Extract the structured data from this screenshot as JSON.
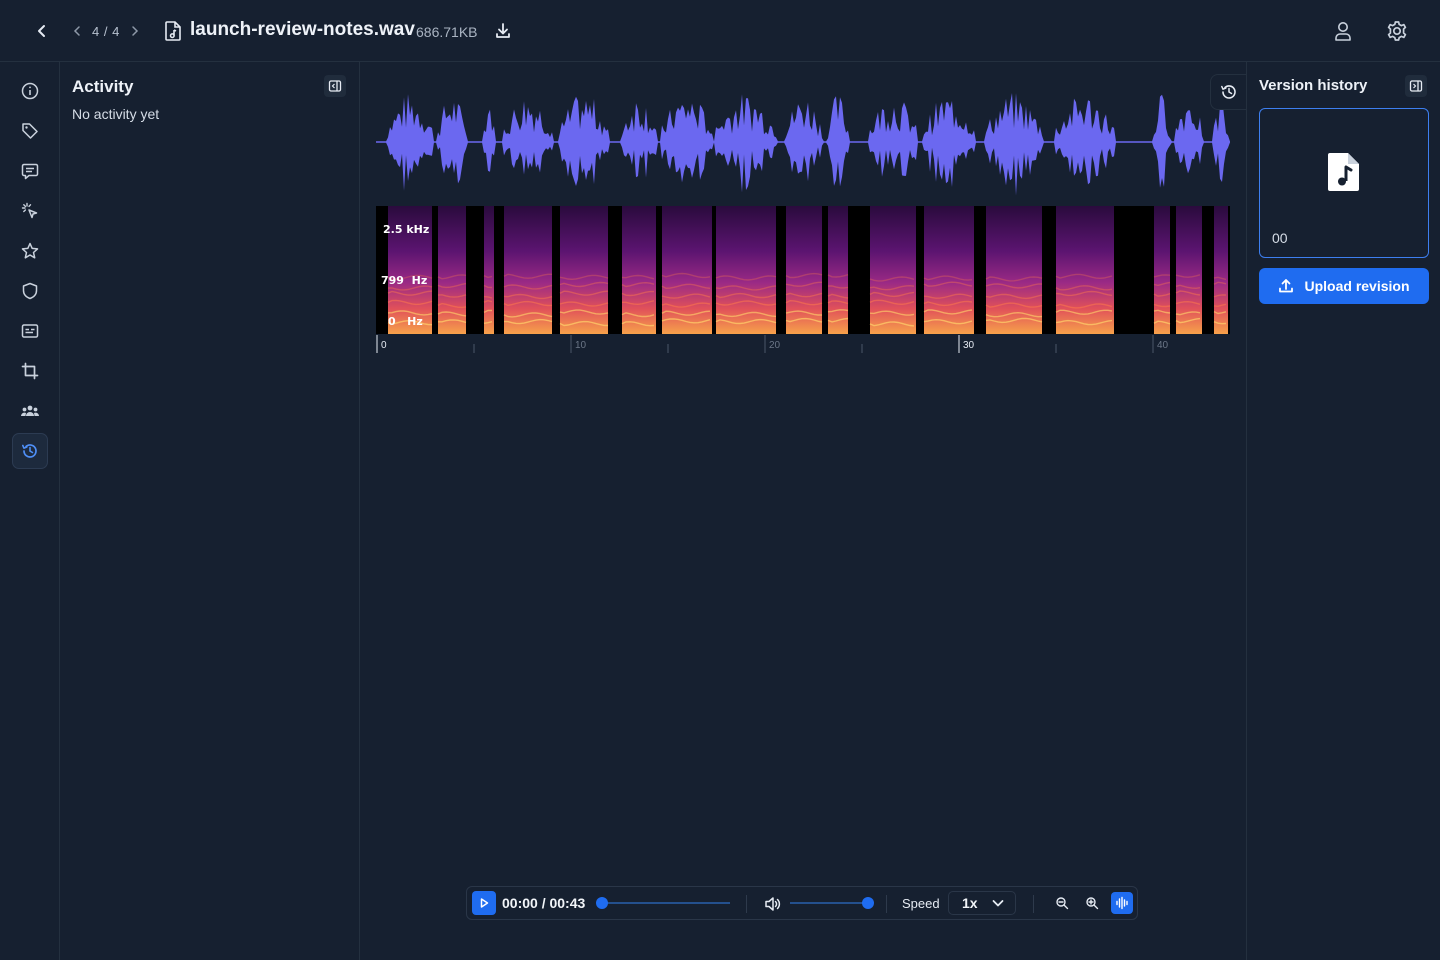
{
  "header": {
    "pager": "4 / 4",
    "file_name": "launch-review-notes.wav",
    "file_size": "686.71KB"
  },
  "sidebar": {
    "items": [
      {
        "name": "info",
        "icon": "info-icon"
      },
      {
        "name": "tags",
        "icon": "tag-icon"
      },
      {
        "name": "comments",
        "icon": "comment-icon"
      },
      {
        "name": "ai",
        "icon": "sparkle-cursor-icon"
      },
      {
        "name": "favorite",
        "icon": "star-icon"
      },
      {
        "name": "security",
        "icon": "shield-icon"
      },
      {
        "name": "captions",
        "icon": "captions-icon"
      },
      {
        "name": "crop",
        "icon": "crop-icon"
      },
      {
        "name": "people",
        "icon": "people-icon"
      },
      {
        "name": "history",
        "icon": "history-icon",
        "active": true
      }
    ]
  },
  "activity": {
    "title": "Activity",
    "empty_text": "No activity yet"
  },
  "spectrogram": {
    "freq_labels": [
      "2.5 kHz",
      "799  Hz",
      "0   Hz"
    ]
  },
  "timeline": {
    "labels": [
      "0",
      "10",
      "20",
      "30",
      "40"
    ]
  },
  "player": {
    "time": "00:00 / 00:43",
    "progress": 0,
    "volume": 1.0,
    "speed_label": "Speed",
    "speed_value": "1x",
    "waveform_mode_on": true
  },
  "version_history": {
    "title": "Version history",
    "version_label": "00",
    "upload_label": "Upload revision"
  },
  "colors": {
    "background": "#162030",
    "accent": "#1f6cf0",
    "waveform": "#6b68f0"
  }
}
